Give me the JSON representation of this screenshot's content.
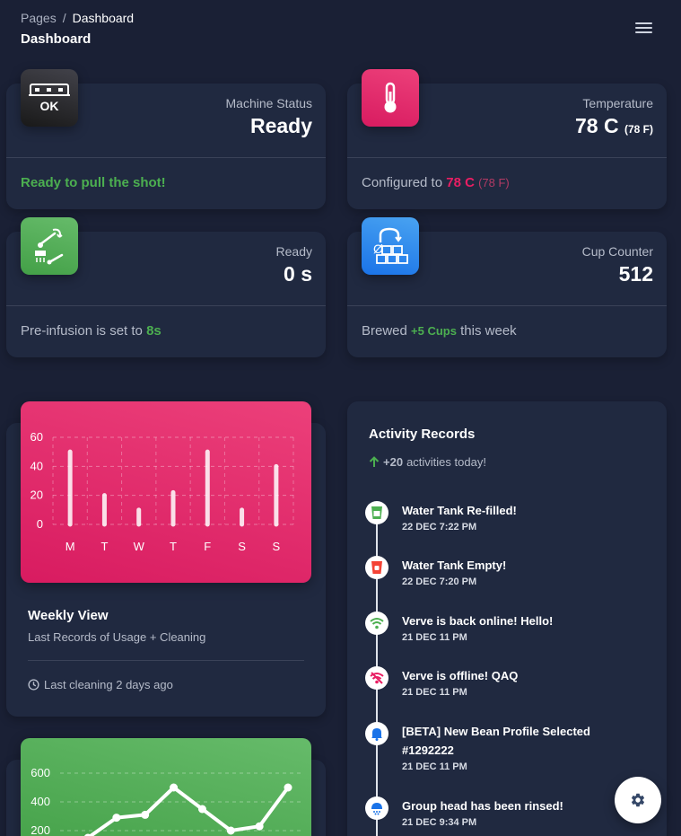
{
  "breadcrumb": {
    "root": "Pages",
    "separator": "/",
    "current": "Dashboard"
  },
  "page_title": "Dashboard",
  "menu_icon": "hamburger-menu-icon",
  "stats": {
    "machine": {
      "label": "Machine Status",
      "value": "Ready",
      "footer": "Ready to pull the shot!",
      "icon": "machine-ok-icon",
      "color": "#42424a"
    },
    "temperature": {
      "label": "Temperature",
      "value": "78 C",
      "value_sub": "(78 F)",
      "footer_prefix": "Configured to",
      "footer_value": "78 C",
      "footer_sub": "(78 F)",
      "icon": "thermometer-icon",
      "color": "#e91e63"
    },
    "ready": {
      "label": "Ready",
      "value": "0 s",
      "footer_prefix": "Pre-infusion is set to",
      "footer_value": "8s",
      "icon": "group-head-icon",
      "color": "#4caf50"
    },
    "cups": {
      "label": "Cup Counter",
      "value": "512",
      "footer_prefix": "Brewed",
      "footer_value": "+5 Cups",
      "footer_suffix": "this week",
      "icon": "cup-counter-icon",
      "color": "#1a73e8"
    }
  },
  "weekly": {
    "title": "Weekly View",
    "subtitle": "Last Records of Usage + Cleaning",
    "footer": "Last cleaning 2 days ago",
    "clock_icon": "clock-icon"
  },
  "chart_data": [
    {
      "type": "bar",
      "categories": [
        "M",
        "T",
        "W",
        "T",
        "F",
        "S",
        "S"
      ],
      "values": [
        50,
        20,
        10,
        22,
        50,
        10,
        40
      ],
      "ylim": [
        0,
        60
      ],
      "yticks": [
        0,
        20,
        40,
        60
      ],
      "grid": true,
      "color": "#ffffff"
    },
    {
      "type": "line",
      "x": [
        0,
        1,
        2,
        3,
        4,
        5,
        6,
        7
      ],
      "values": [
        150,
        290,
        310,
        500,
        350,
        200,
        230,
        500
      ],
      "ylim": [
        0,
        600
      ],
      "yticks": [
        200,
        400,
        600
      ],
      "grid": true,
      "color": "#ffffff"
    }
  ],
  "activity": {
    "title": "Activity Records",
    "count": "+20",
    "count_suffix": "activities today!",
    "up_icon": "arrow-up-icon",
    "items": [
      {
        "title": "Water Tank Re-filled!",
        "time": "22 DEC 7:22 PM",
        "icon": "water-tank-full-icon",
        "color": "#4caf50"
      },
      {
        "title": "Water Tank Empty!",
        "time": "22 DEC 7:20 PM",
        "icon": "water-tank-empty-icon",
        "color": "#f44335"
      },
      {
        "title": "Verve is back online! Hello!",
        "time": "21 DEC 11 PM",
        "icon": "wifi-icon",
        "color": "#4caf50"
      },
      {
        "title": "Verve is offline! QAQ",
        "time": "21 DEC 11 PM",
        "icon": "wifi-off-icon",
        "color": "#e91e63"
      },
      {
        "title": "[BETA] New Bean Profile Selected #1292222",
        "time": "21 DEC 11 PM",
        "icon": "bell-icon",
        "color": "#1a73e8"
      },
      {
        "title": "Group head has been rinsed!",
        "time": "21 DEC 9:34 PM",
        "icon": "shower-head-icon",
        "color": "#1a73e8"
      }
    ]
  },
  "settings_icon": "gear-icon"
}
